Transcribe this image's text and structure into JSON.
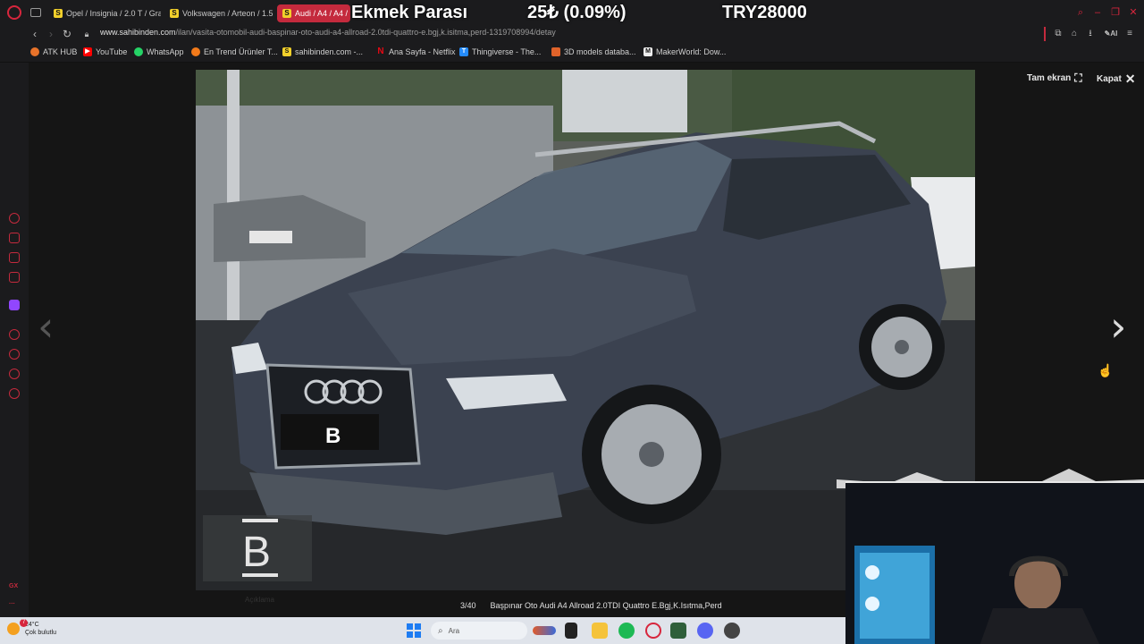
{
  "tabs": [
    {
      "label": "Opel / Insignia / 2.0 T / Gra",
      "favicon": "S",
      "active": false
    },
    {
      "label": "Volkswagen / Arteon / 1.5",
      "favicon": "S",
      "active": false
    },
    {
      "label": "Audi / A4 / A4 /",
      "favicon": "S",
      "active": true
    }
  ],
  "stream_overlay": {
    "ticker_name": "Ekmek Parası",
    "ticker_change": "25₺ (0.09%)",
    "ticker_total": "TRY28000"
  },
  "address": {
    "domain": "www.sahibinden.com",
    "path": "/ilan/vasita-otomobil-audi-baspinar-oto-audi-a4-allroad-2.0tdi-quattro-e.bgj,k.isitma,perd-1319708994/detay"
  },
  "bookmarks": [
    {
      "label": "ATK HUB",
      "icon": "atk-icon",
      "color": "#e8732a"
    },
    {
      "label": "YouTube",
      "icon": "youtube-icon",
      "color": "#ff0000"
    },
    {
      "label": "WhatsApp",
      "icon": "whatsapp-icon",
      "color": "#25d366"
    },
    {
      "label": "En Trend Ürünler T...",
      "icon": "trendyol-icon",
      "color": "#f27a1a"
    },
    {
      "label": "sahibinden.com -...",
      "icon": "sahibinden-icon",
      "color": "#f2d02b"
    },
    {
      "label": "Ana Sayfa - Netflix",
      "icon": "netflix-icon",
      "color": "#e50914"
    },
    {
      "label": "Thingiverse - The...",
      "icon": "thingiverse-icon",
      "color": "#248bfb"
    },
    {
      "label": "3D models databa...",
      "icon": "3d-models-icon",
      "color": "#e0632a"
    },
    {
      "label": "MakerWorld: Dow...",
      "icon": "makerworld-icon",
      "color": "#eeeeee"
    }
  ],
  "viewer": {
    "fullscreen_label": "Tam ekran",
    "close_label": "Kapat",
    "counter": "3/40",
    "caption": "Başpınar Oto Audi A4 Allroad 2.0TDI Quattro E.Bgj,K.Isıtma,Perd",
    "plate_letter": "B",
    "watermark_letter": "B",
    "hidden_label": "Açıklama"
  },
  "taskbar": {
    "temperature": "24°C",
    "weather": "Çok bulutlu",
    "search_placeholder": "Ara",
    "weather_badge": "7"
  },
  "colors": {
    "accent": "#c42a3d",
    "brand_yellow": "#f2d02b"
  }
}
